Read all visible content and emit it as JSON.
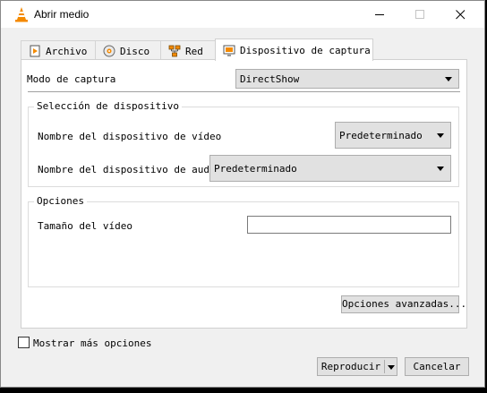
{
  "window": {
    "title": "Abrir medio"
  },
  "tabs": [
    {
      "label": "Archivo"
    },
    {
      "label": "Disco"
    },
    {
      "label": "Red"
    },
    {
      "label": "Dispositivo de captura"
    }
  ],
  "capture": {
    "mode_label": "Modo de captura",
    "mode_value": "DirectShow"
  },
  "device_selection": {
    "title": "Selección de dispositivo",
    "video_label": "Nombre del dispositivo de vídeo",
    "video_value": "Predeterminado",
    "audio_label": "Nombre del dispositivo de audio",
    "audio_value": "Predeterminado"
  },
  "options": {
    "title": "Opciones",
    "video_size_label": "Tamaño del vídeo",
    "video_size_value": "",
    "advanced_button": "Opciones avanzadas..."
  },
  "footer": {
    "show_more_label": "Mostrar más opciones",
    "show_more_checked": false,
    "play_button": "Reproducir",
    "cancel_button": "Cancelar"
  },
  "colors": {
    "accent": "#f48a00"
  }
}
